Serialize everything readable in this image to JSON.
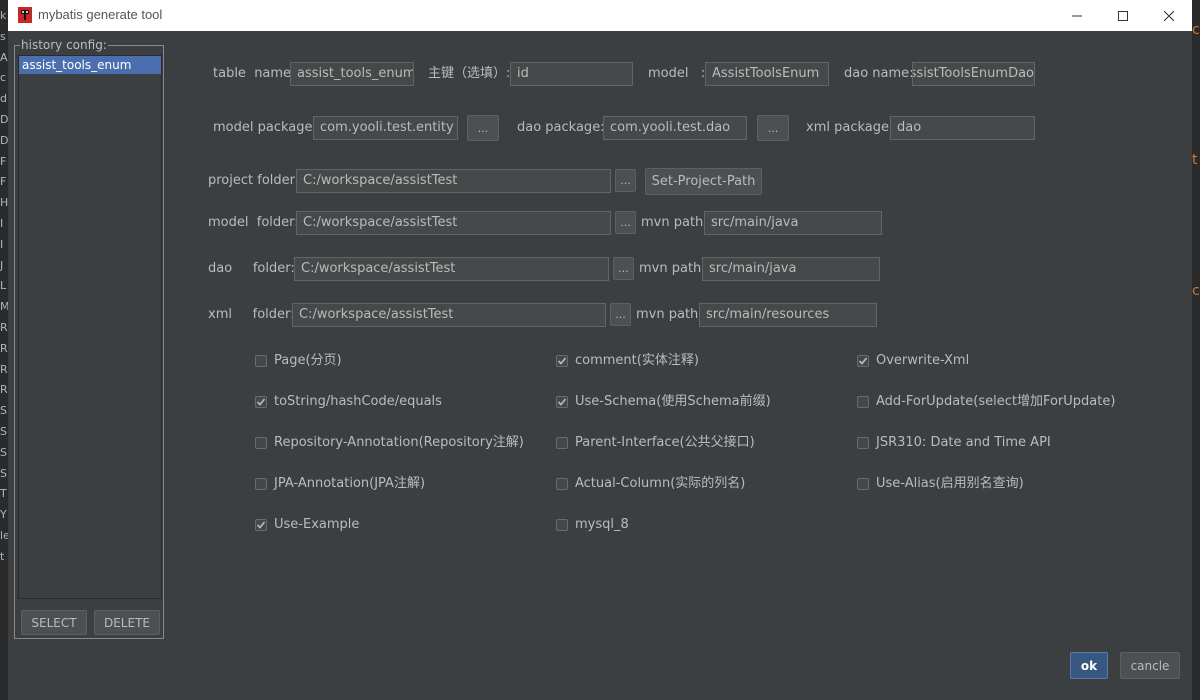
{
  "window": {
    "title": "mybatis generate tool"
  },
  "bg_chars": [
    "k",
    "s",
    "A",
    "c",
    "d",
    "D",
    "D",
    "F",
    "F",
    "H",
    "I",
    "I",
    "J",
    "L",
    "M",
    "R",
    "R",
    "R",
    "R",
    "S",
    "S",
    "S",
    "S",
    "T",
    "Y",
    "le",
    "t"
  ],
  "bg_right_chars": [
    "c",
    "t",
    "c"
  ],
  "history": {
    "label": "history config:",
    "items": [
      "assist_tools_enum"
    ],
    "select_label": "SELECT",
    "delete_label": "DELETE"
  },
  "form": {
    "table_name_label": "table  name:",
    "table_name": "assist_tools_enum",
    "pk_label": "主键（选填）:",
    "pk": "id",
    "model_label": "model   :",
    "model": "AssistToolsEnum",
    "dao_name_label": "dao name:",
    "dao_name": "AssistToolsEnumDao",
    "model_package_label": "model package:",
    "model_package": "com.yooli.test.entity",
    "dao_package_label": "dao package:",
    "dao_package": "com.yooli.test.dao",
    "xml_package_label": "xml package:",
    "xml_package": "dao",
    "browse_label": "...",
    "project_folder_label": "project folder:",
    "project_folder": "C:/workspace/assistTest",
    "set_project_path_label": "Set-Project-Path",
    "model_folder_label": "model  folder:",
    "model_folder": "C:/workspace/assistTest",
    "model_mvn_label": "mvn path:",
    "model_mvn": "src/main/java",
    "dao_folder_label": "dao     folder:",
    "dao_folder": "C:/workspace/assistTest",
    "dao_mvn_label": "mvn path:",
    "dao_mvn": "src/main/java",
    "xml_folder_label": "xml     folder:",
    "xml_folder": "C:/workspace/assistTest",
    "xml_mvn_label": "mvn path:",
    "xml_mvn": "src/main/resources"
  },
  "options": [
    {
      "label": "Page(分页)",
      "checked": false
    },
    {
      "label": "comment(实体注释)",
      "checked": true
    },
    {
      "label": "Overwrite-Xml",
      "checked": true
    },
    {
      "label": "toString/hashCode/equals",
      "checked": true
    },
    {
      "label": "Use-Schema(使用Schema前缀)",
      "checked": true
    },
    {
      "label": "Add-ForUpdate(select增加ForUpdate)",
      "checked": false
    },
    {
      "label": "Repository-Annotation(Repository注解)",
      "checked": false
    },
    {
      "label": "Parent-Interface(公共父接口)",
      "checked": false
    },
    {
      "label": "JSR310: Date and Time API",
      "checked": false
    },
    {
      "label": "JPA-Annotation(JPA注解)",
      "checked": false
    },
    {
      "label": "Actual-Column(实际的列名)",
      "checked": false
    },
    {
      "label": "Use-Alias(启用别名查询)",
      "checked": false
    },
    {
      "label": "Use-Example",
      "checked": true
    },
    {
      "label": "mysql_8",
      "checked": false
    }
  ],
  "footer": {
    "ok_label": "ok",
    "cancel_label": "cancle"
  },
  "colors": {
    "dialog_bg": "#3c3f41",
    "selection": "#4b6eaf",
    "ok_button": "#365880"
  }
}
